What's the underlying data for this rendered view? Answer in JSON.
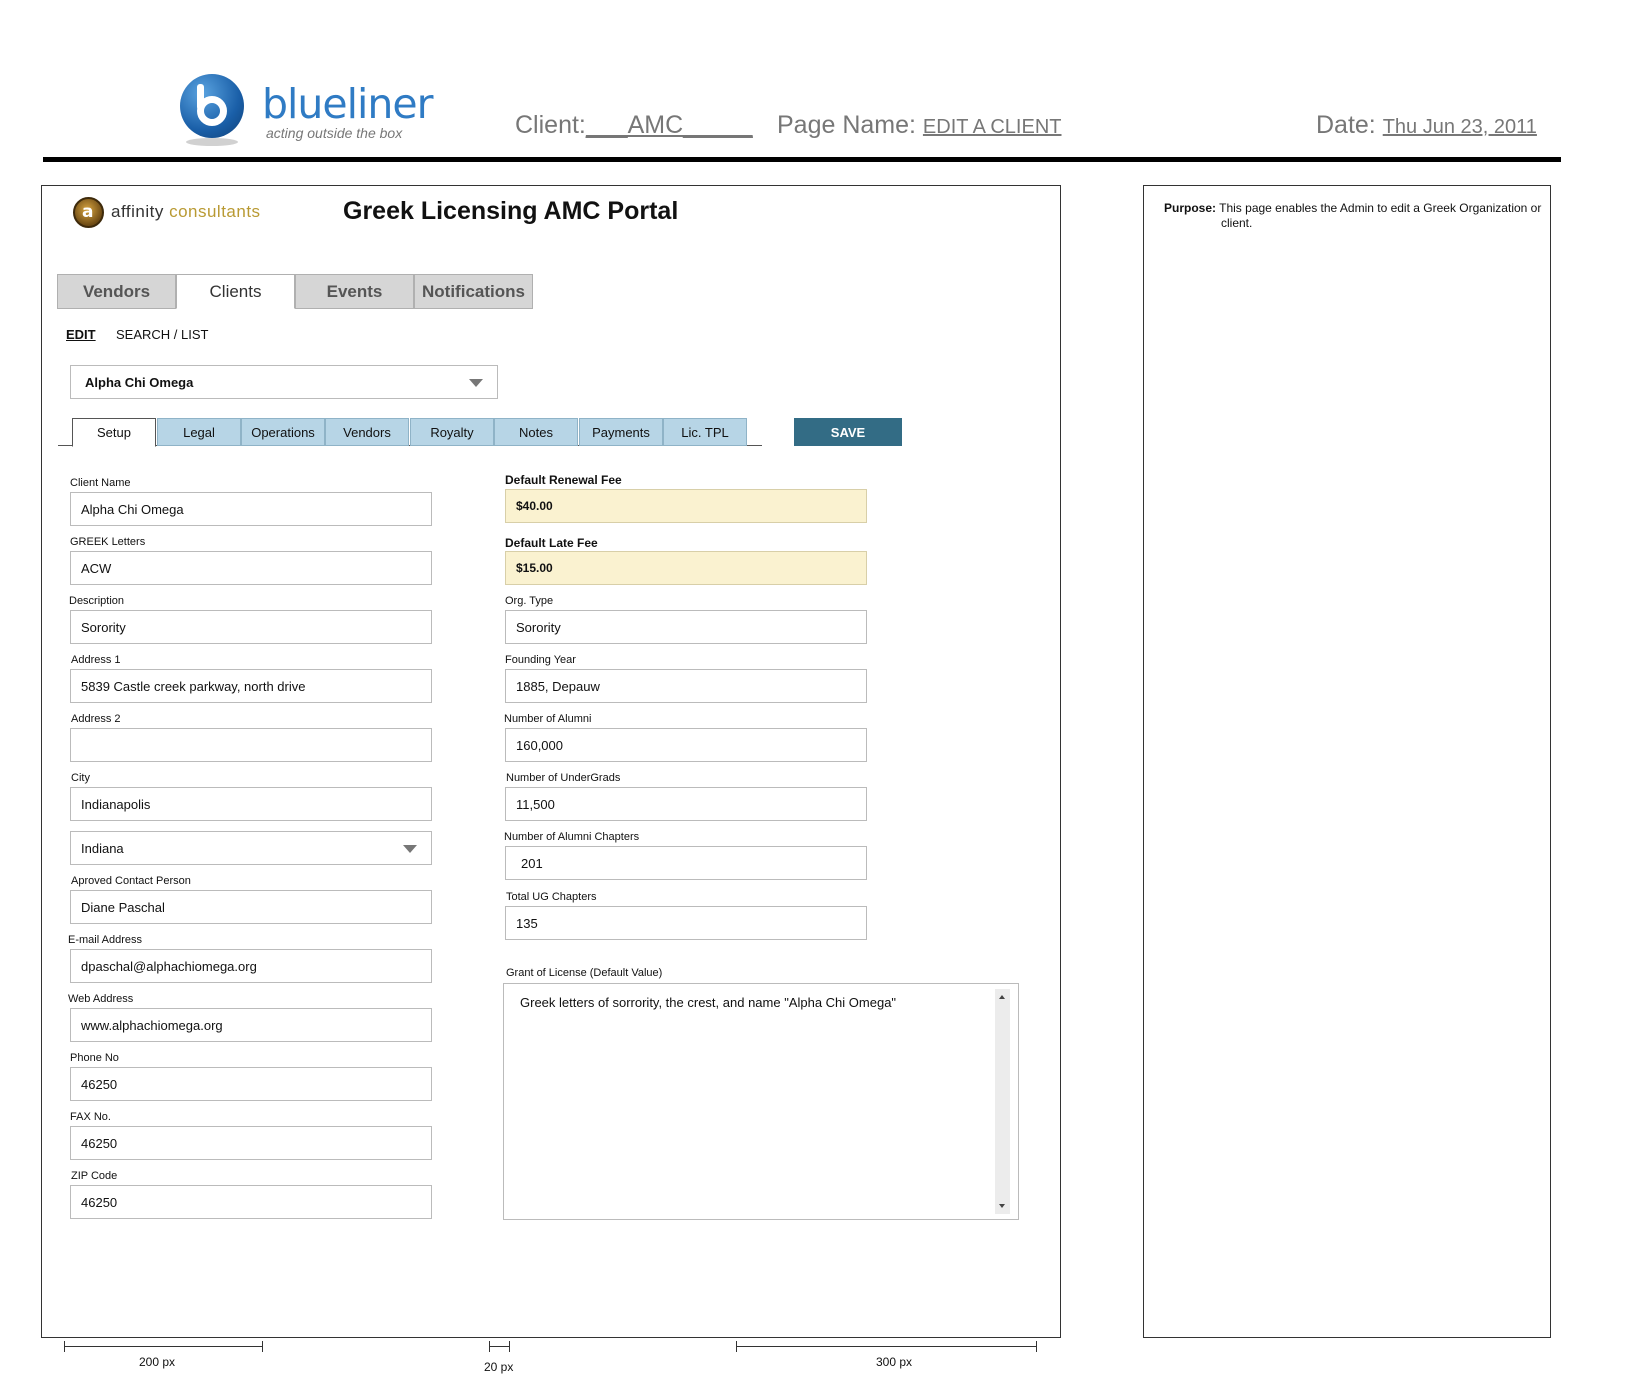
{
  "header": {
    "brand": "blueliner",
    "tagline": "acting outside the box",
    "client_label": "Client:",
    "client_value": "___AMC_____",
    "page_name_label": "Page Name:",
    "page_name_value": "EDIT A CLIENT",
    "date_label": "Date:",
    "date_value": "Thu Jun 23, 2011"
  },
  "app": {
    "logo_glyph": "a",
    "company_name": "affinity",
    "company_name_accent": "consultants",
    "title": "Greek Licensing AMC Portal"
  },
  "main_tabs": [
    {
      "label": "Vendors",
      "active": false
    },
    {
      "label": "Clients",
      "active": true
    },
    {
      "label": "Events",
      "active": false
    },
    {
      "label": "Notifications",
      "active": false
    }
  ],
  "subnav": {
    "edit": "EDIT",
    "search_list": "SEARCH / LIST"
  },
  "client_select": {
    "value": "Alpha Chi Omega"
  },
  "sub_tabs": [
    {
      "label": "Setup",
      "active": true
    },
    {
      "label": "Legal",
      "active": false
    },
    {
      "label": "Operations",
      "active": false
    },
    {
      "label": "Vendors",
      "active": false
    },
    {
      "label": "Royalty",
      "active": false
    },
    {
      "label": "Notes",
      "active": false
    },
    {
      "label": "Payments",
      "active": false
    },
    {
      "label": "Lic. TPL",
      "active": false
    }
  ],
  "save_label": "SAVE",
  "left_fields": {
    "client_name": {
      "label": "Client Name",
      "value": "Alpha Chi Omega"
    },
    "greek_letters": {
      "label": "GREEK Letters",
      "value": "ACW"
    },
    "description": {
      "label": "Description",
      "value": "Sorority"
    },
    "address1": {
      "label": "Address 1",
      "value": "5839 Castle creek parkway, north drive"
    },
    "address2": {
      "label": "Address 2",
      "value": ""
    },
    "city": {
      "label": "City",
      "value": "Indianapolis"
    },
    "state": {
      "value": "Indiana"
    },
    "contact": {
      "label": "Aproved Contact Person",
      "value": "Diane Paschal"
    },
    "email": {
      "label": "E-mail Address",
      "value": "dpaschal@alphachiomega.org"
    },
    "web": {
      "label": "Web Address",
      "value": "www.alphachiomega.org"
    },
    "phone": {
      "label": "Phone No",
      "value": "46250"
    },
    "fax": {
      "label": "FAX No.",
      "value": "46250"
    },
    "zip": {
      "label": "ZIP Code",
      "value": "46250"
    }
  },
  "right_fields": {
    "renewal_fee": {
      "label": "Default Renewal Fee",
      "value": "$40.00"
    },
    "late_fee": {
      "label": "Default Late Fee",
      "value": "$15.00"
    },
    "org_type": {
      "label": "Org. Type",
      "value": "Sorority"
    },
    "founding_year": {
      "label": "Founding Year",
      "value": "1885, Depauw"
    },
    "alumni": {
      "label": "Number of Alumni",
      "value": "160,000"
    },
    "undergrads": {
      "label": "Number of UnderGrads",
      "value": "11,500"
    },
    "alumni_chapters": {
      "label": "Number of Alumni Chapters",
      "value": "201"
    },
    "ug_chapters": {
      "label": "Total UG Chapters",
      "value": "135"
    },
    "grant": {
      "label": "Grant of License (Default Value)",
      "value": "Greek letters of sorrority, the crest, and name \"Alpha Chi Omega\""
    }
  },
  "notes": {
    "purpose_label": "Purpose:",
    "purpose_text": "This page enables the Admin to edit a Greek Organization or client."
  },
  "rulers": {
    "r1": "200 px",
    "r2": "20 px",
    "r3": "300 px"
  },
  "colors": {
    "tab_blue": "#b7d5e6",
    "save_button": "#336c85",
    "fee_highlight": "#faf2d0",
    "brand_blue": "#2f7bc4"
  }
}
